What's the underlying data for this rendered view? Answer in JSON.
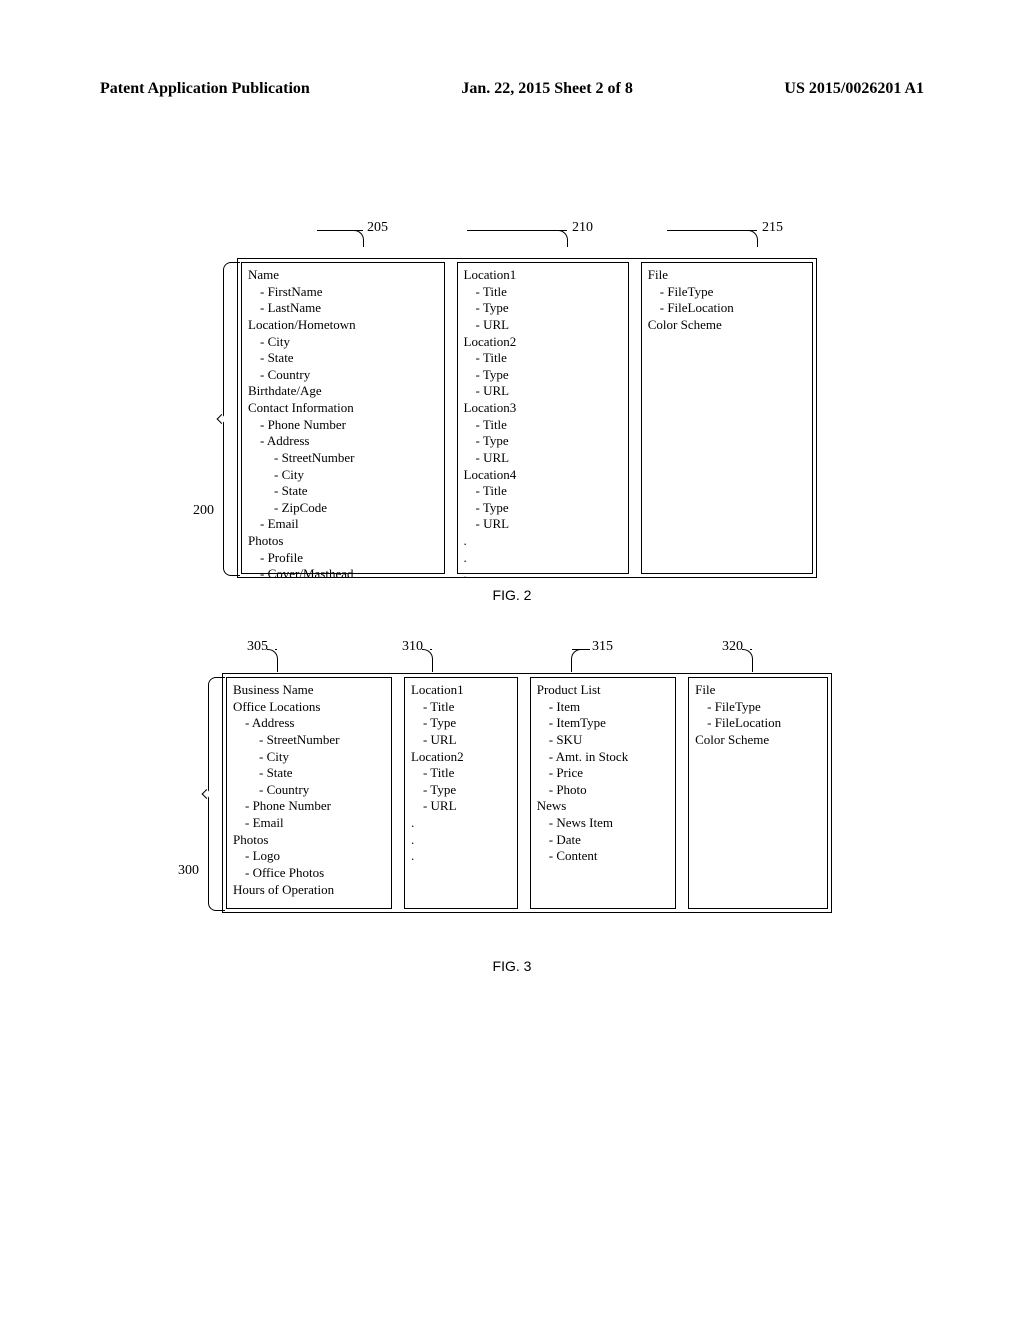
{
  "header": {
    "left": "Patent Application Publication",
    "center": "Jan. 22, 2015  Sheet 2 of 8",
    "right": "US 2015/0026201 A1"
  },
  "fig2": {
    "ref_outer": "200",
    "ref_box1": "205",
    "ref_box2": "210",
    "ref_box3": "215",
    "caption": "FIG. 2",
    "box1": [
      {
        "l": 0,
        "t": "Name"
      },
      {
        "l": 1,
        "t": "- FirstName"
      },
      {
        "l": 1,
        "t": "- LastName"
      },
      {
        "l": 0,
        "t": "Location/Hometown"
      },
      {
        "l": 1,
        "t": "- City"
      },
      {
        "l": 1,
        "t": "- State"
      },
      {
        "l": 1,
        "t": "- Country"
      },
      {
        "l": 0,
        "t": "Birthdate/Age"
      },
      {
        "l": 0,
        "t": "Contact Information"
      },
      {
        "l": 1,
        "t": "- Phone Number"
      },
      {
        "l": 1,
        "t": "- Address"
      },
      {
        "l": 2,
        "t": "- StreetNumber"
      },
      {
        "l": 2,
        "t": "- City"
      },
      {
        "l": 2,
        "t": "- State"
      },
      {
        "l": 2,
        "t": "- ZipCode"
      },
      {
        "l": 1,
        "t": "- Email"
      },
      {
        "l": 0,
        "t": "Photos"
      },
      {
        "l": 1,
        "t": "- Profile"
      },
      {
        "l": 1,
        "t": "- Cover/Masthead"
      }
    ],
    "box2": [
      {
        "l": 0,
        "t": "Location1"
      },
      {
        "l": 1,
        "t": "- Title"
      },
      {
        "l": 1,
        "t": "- Type"
      },
      {
        "l": 1,
        "t": "- URL"
      },
      {
        "l": 0,
        "t": "Location2"
      },
      {
        "l": 1,
        "t": "- Title"
      },
      {
        "l": 1,
        "t": "- Type"
      },
      {
        "l": 1,
        "t": "- URL"
      },
      {
        "l": 0,
        "t": "Location3"
      },
      {
        "l": 1,
        "t": "- Title"
      },
      {
        "l": 1,
        "t": "- Type"
      },
      {
        "l": 1,
        "t": "- URL"
      },
      {
        "l": 0,
        "t": "Location4"
      },
      {
        "l": 1,
        "t": "- Title"
      },
      {
        "l": 1,
        "t": "- Type"
      },
      {
        "l": 1,
        "t": "- URL"
      },
      {
        "l": 0,
        "t": "."
      },
      {
        "l": 0,
        "t": "."
      },
      {
        "l": 0,
        "t": "."
      }
    ],
    "box3": [
      {
        "l": 0,
        "t": "File"
      },
      {
        "l": 1,
        "t": "- FileType"
      },
      {
        "l": 1,
        "t": "- FileLocation"
      },
      {
        "l": 0,
        "t": "Color Scheme"
      }
    ]
  },
  "fig3": {
    "ref_outer": "300",
    "ref_box1": "305",
    "ref_box2": "310",
    "ref_box3": "315",
    "ref_box4": "320",
    "caption": "FIG. 3",
    "box1": [
      {
        "l": 0,
        "t": "Business Name"
      },
      {
        "l": 0,
        "t": "Office Locations"
      },
      {
        "l": 1,
        "t": "- Address"
      },
      {
        "l": 2,
        "t": "- StreetNumber"
      },
      {
        "l": 2,
        "t": "- City"
      },
      {
        "l": 2,
        "t": "- State"
      },
      {
        "l": 2,
        "t": "- Country"
      },
      {
        "l": 1,
        "t": "- Phone Number"
      },
      {
        "l": 1,
        "t": "- Email"
      },
      {
        "l": 0,
        "t": "Photos"
      },
      {
        "l": 1,
        "t": "- Logo"
      },
      {
        "l": 1,
        "t": "- Office Photos"
      },
      {
        "l": 0,
        "t": "Hours of Operation"
      }
    ],
    "box2": [
      {
        "l": 0,
        "t": "Location1"
      },
      {
        "l": 1,
        "t": "- Title"
      },
      {
        "l": 1,
        "t": "- Type"
      },
      {
        "l": 1,
        "t": "- URL"
      },
      {
        "l": 0,
        "t": "Location2"
      },
      {
        "l": 1,
        "t": "- Title"
      },
      {
        "l": 1,
        "t": "- Type"
      },
      {
        "l": 1,
        "t": "- URL"
      },
      {
        "l": 0,
        "t": "."
      },
      {
        "l": 0,
        "t": "."
      },
      {
        "l": 0,
        "t": "."
      }
    ],
    "box3": [
      {
        "l": 0,
        "t": "Product List"
      },
      {
        "l": 1,
        "t": "- Item"
      },
      {
        "l": 1,
        "t": "- ItemType"
      },
      {
        "l": 1,
        "t": "- SKU"
      },
      {
        "l": 1,
        "t": "- Amt. in Stock"
      },
      {
        "l": 1,
        "t": "- Price"
      },
      {
        "l": 1,
        "t": "- Photo"
      },
      {
        "l": 0,
        "t": "News"
      },
      {
        "l": 1,
        "t": "- News Item"
      },
      {
        "l": 1,
        "t": "- Date"
      },
      {
        "l": 1,
        "t": "- Content"
      }
    ],
    "box4": [
      {
        "l": 0,
        "t": "File"
      },
      {
        "l": 1,
        "t": "- FileType"
      },
      {
        "l": 1,
        "t": "- FileLocation"
      },
      {
        "l": 0,
        "t": "Color Scheme"
      }
    ]
  }
}
